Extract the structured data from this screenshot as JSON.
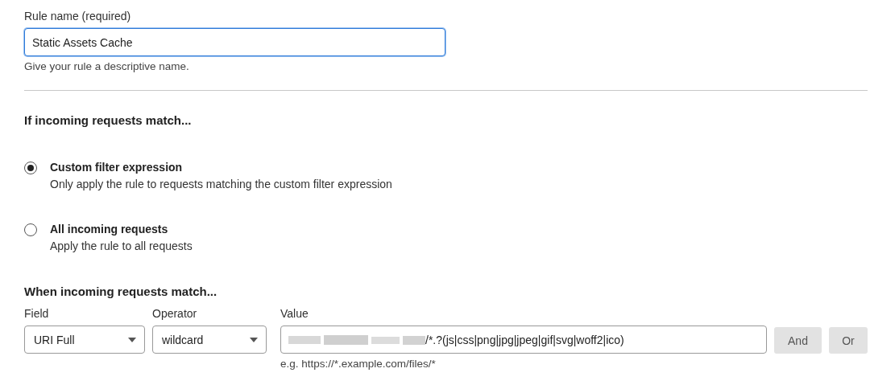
{
  "rule_name": {
    "label": "Rule name (required)",
    "value": "Static Assets Cache",
    "hint": "Give your rule a descriptive name.",
    "focused": true
  },
  "match_heading": "If incoming requests match...",
  "match_options": [
    {
      "title": "Custom filter expression",
      "description": "Only apply the rule to requests matching the custom filter expression",
      "selected": true
    },
    {
      "title": "All incoming requests",
      "description": "Apply the rule to all requests",
      "selected": false
    }
  ],
  "expression": {
    "heading": "When incoming requests match...",
    "field": {
      "label": "Field",
      "value": "URI Full"
    },
    "operator": {
      "label": "Operator",
      "value": "wildcard"
    },
    "value": {
      "label": "Value",
      "value": "/*.?(js|css|png|jpg|jpeg|gif|svg|woff2|ico)",
      "redacted_prefix": true,
      "hint": "e.g. https://*.example.com/files/*"
    },
    "buttons": [
      {
        "label": "And",
        "disabled": true
      },
      {
        "label": "Or",
        "disabled": true
      }
    ]
  }
}
